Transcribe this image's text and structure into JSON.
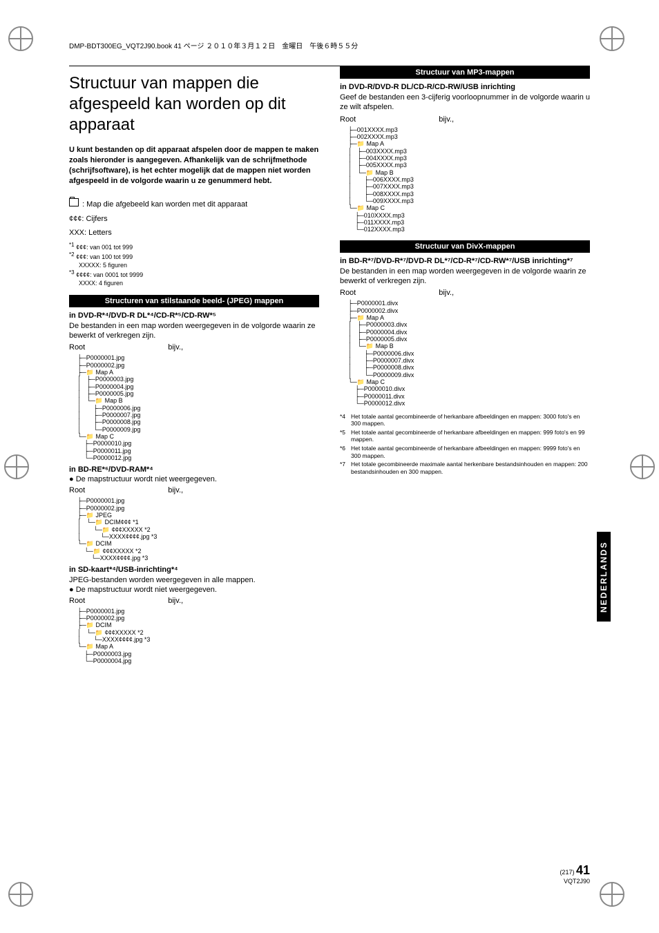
{
  "header": "DMP-BDT300EG_VQT2J90.book  41 ページ  ２０１０年３月１２日　金曜日　午後６時５５分",
  "title": "Structuur van mappen die afgespeeld kan worden op dit apparaat",
  "intro": "U kunt bestanden op dit apparaat afspelen door de mappen te maken zoals hieronder is aangegeven. Afhankelijk van de schrijfmethode (schrijfsoftware), is het echter mogelijk dat de mappen niet worden afgespeeld in de volgorde waarin u ze genummerd hebt.",
  "legend": {
    "folder": ": Map die afgebeeld kan worden met dit apparaat",
    "stars3": "¢¢¢: Cijfers",
    "xxx": "XXX: Letters",
    "n1": "¢¢¢: van 001 tot 999",
    "n2": "¢¢¢: van 100 tot 999",
    "n2b": "XXXXX: 5 figuren",
    "n3": "¢¢¢¢: van 0001 tot 9999",
    "n3b": "XXXX: 4 figuren"
  },
  "bars": {
    "jpeg": "Structuren van stilstaande beeld- (JPEG) mappen",
    "mp3": "Structuur van MP3-mappen",
    "divx": "Structuur van DivX-mappen"
  },
  "sections": {
    "jpeg1_head": "in DVD-R*⁴/DVD-R DL*⁴/CD-R*⁵/CD-RW*⁵",
    "jpeg1_body": "De bestanden in een map worden weergegeven in de volgorde waarin ze bewerkt of verkregen zijn.",
    "root": "Root",
    "bijv": "bijv.,",
    "bdre_head": "in BD-RE*⁶/DVD-RAM*⁴",
    "bdre_body": "● De mapstructuur wordt niet weergegeven.",
    "sd_head": "in SD-kaart*⁴/USB-inrichting*⁴",
    "sd_body1": "JPEG-bestanden worden weergegeven in alle mappen.",
    "sd_body2": "● De mapstructuur wordt niet weergegeven.",
    "mp3_head": "in DVD-R/DVD-R DL/CD-R/CD-RW/USB inrichting",
    "mp3_body": "Geef de bestanden een 3-cijferig voorloopnummer in de volgorde waarin u ze wilt afspelen.",
    "divx_head": "in BD-R*⁷/DVD-R*⁷/DVD-R DL*⁷/CD-R*⁷/CD-RW*⁷/USB inrichting*⁷",
    "divx_body": "De bestanden in een map worden weergegeven in de volgorde waarin ze bewerkt of verkregen zijn."
  },
  "trees": {
    "jpeg1": "├─P0000001.jpg\n├─P0000002.jpg\n├─📁 Map A\n│   ├─P0000003.jpg\n│   ├─P0000004.jpg\n│   ├─P0000005.jpg\n│   └─📁 Map B\n│       ├─P0000006.jpg\n│       ├─P0000007.jpg\n│       ├─P0000008.jpg\n│       └─P0000009.jpg\n└─📁 Map C\n    ├─P0000010.jpg\n    ├─P0000011.jpg\n    └─P0000012.jpg",
    "bdre": "├─P0000001.jpg\n├─P0000002.jpg\n├─📁 JPEG\n│   └─📁 DCIM¢¢¢ *1\n│       └─📁 ¢¢¢XXXXX *2\n│           └─XXXX¢¢¢¢.jpg *3\n└─📁 DCIM\n    └─📁 ¢¢¢XXXXX *2\n        └─XXXX¢¢¢¢.jpg *3",
    "sd": "├─P0000001.jpg\n├─P0000002.jpg\n├─📁 DCIM\n│   └─📁 ¢¢¢XXXXX *2\n│       └─XXXX¢¢¢¢.jpg *3\n└─📁 Map A\n    ├─P0000003.jpg\n    └─P0000004.jpg",
    "mp3": "├─001XXXX.mp3\n├─002XXXX.mp3\n├─📁 Map A\n│   ├─003XXXX.mp3\n│   ├─004XXXX.mp3\n│   ├─005XXXX.mp3\n│   └─📁 Map B\n│       ├─006XXXX.mp3\n│       ├─007XXXX.mp3\n│       ├─008XXXX.mp3\n│       └─009XXXX.mp3\n└─📁 Map C\n    ├─010XXXX.mp3\n    ├─011XXXX.mp3\n    └─012XXXX.mp3",
    "divx": "├─P0000001.divx\n├─P0000002.divx\n├─📁 Map A\n│   ├─P0000003.divx\n│   ├─P0000004.divx\n│   ├─P0000005.divx\n│   └─📁 Map B\n│       ├─P0000006.divx\n│       ├─P0000007.divx\n│       ├─P0000008.divx\n│       └─P0000009.divx\n└─📁 Map C\n    ├─P0000010.divx\n    ├─P0000011.divx\n    └─P0000012.divx"
  },
  "footnotes": {
    "f4": "Het totale aantal gecombineerde of herkanbare afbeeldingen en mappen: 3000 foto's en 300 mappen.",
    "f5": "Het totale aantal gecombineerde of herkanbare afbeeldingen en mappen: 999 foto's en 99 mappen.",
    "f6": "Het totale aantal gecombineerde of herkanbare afbeeldingen en mappen: 9999 foto's en 300 mappen.",
    "f7": "Het totale gecombineerde maximale aantal herkenbare bestandsinhouden en mappen: 200 bestandsinhouden en 300 mappen."
  },
  "lang_tab": "NEDERLANDS",
  "page": {
    "paren": "(217)",
    "num": "41",
    "code": "VQT2J90"
  }
}
